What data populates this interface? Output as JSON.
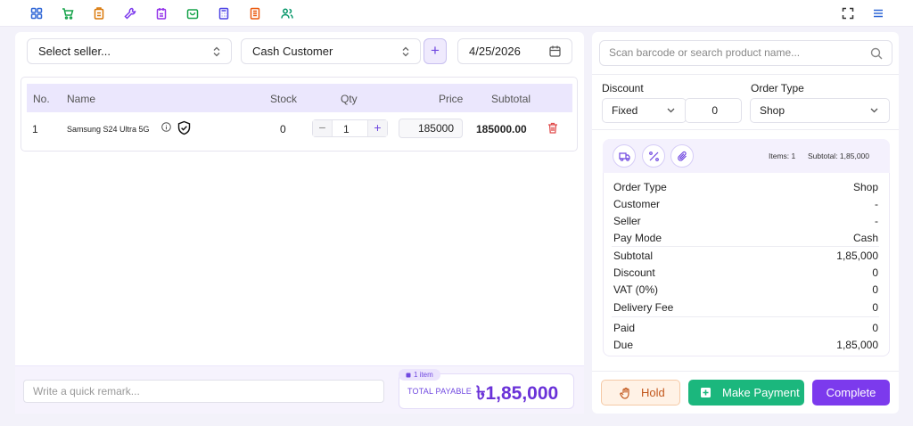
{
  "toolbar": {
    "icons": [
      "dashboard-icon",
      "cart-icon",
      "clipboard-icon",
      "wrench-icon",
      "notes-icon",
      "bag-icon",
      "calculator-icon",
      "document-icon",
      "users-icon"
    ],
    "right_icons": [
      "fullscreen-icon",
      "menu-icon"
    ]
  },
  "sale": {
    "seller_placeholder": "Select seller...",
    "customer": "Cash Customer",
    "add_label": "+",
    "date": "4/25/2026"
  },
  "table": {
    "headers": {
      "no": "No.",
      "name": "Name",
      "stock": "Stock",
      "qty": "Qty",
      "price": "Price",
      "subtotal": "Subtotal"
    },
    "rows": [
      {
        "no": "1",
        "name": "Samsung S24 Ultra 5G",
        "stock": "0",
        "qty": "1",
        "price": "185000",
        "subtotal": "185000.00"
      }
    ]
  },
  "footer": {
    "remark_placeholder": "Write a quick remark...",
    "items_badge": "1 item",
    "total_label": "TOTAL PAYABLE",
    "total_value": "৳1,85,000"
  },
  "search": {
    "placeholder": "Scan barcode or search product name..."
  },
  "order": {
    "discount_label": "Discount",
    "discount_type": "Fixed",
    "discount_value": "0",
    "order_type_label": "Order Type",
    "order_type": "Shop"
  },
  "summary": {
    "items_text": "Items: 1",
    "subtotal_text": "Subtotal: 1,85,000",
    "rows": [
      {
        "label": "Order Type",
        "value": "Shop"
      },
      {
        "label": "Customer",
        "value": "-"
      },
      {
        "label": "Seller",
        "value": "-"
      },
      {
        "label": "Pay Mode",
        "value": "Cash"
      },
      {
        "label": "Subtotal",
        "value": "1,85,000"
      },
      {
        "label": "Discount",
        "value": "0"
      },
      {
        "label": "VAT (0%)",
        "value": "0"
      },
      {
        "label": "Delivery Fee",
        "value": "0"
      },
      {
        "label": "Paid",
        "value": "0"
      },
      {
        "label": "Due",
        "value": "1,85,000"
      }
    ]
  },
  "actions": {
    "hold": "Hold",
    "make_payment": "Make Payment",
    "complete": "Complete"
  },
  "colors": {
    "accent": "#7c3aed",
    "success": "#1bb77d",
    "hold": "#c2571c"
  }
}
